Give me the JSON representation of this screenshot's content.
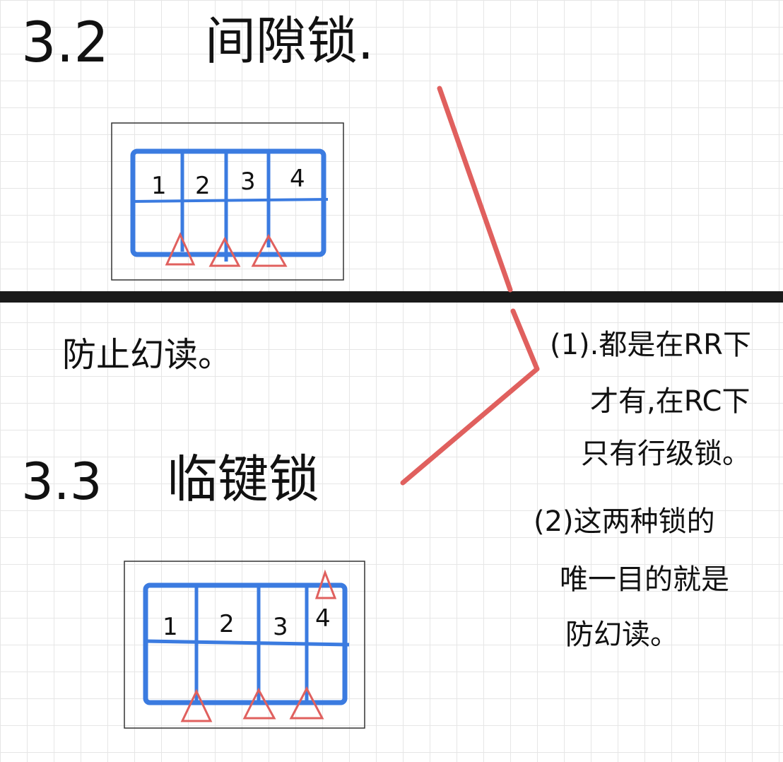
{
  "section_gap": {
    "number": "3.2",
    "title": "间隙锁."
  },
  "section_nextkey": {
    "number": "3.3",
    "title": "临键锁"
  },
  "purpose_note": "防止幻读。",
  "notes": [
    "(1).都是在RR下",
    "才有,在RC下",
    "只有行级锁。",
    "(2)这两种锁的",
    "唯一目的就是",
    "防幻读。"
  ],
  "gap_table": {
    "cells": [
      "1",
      "2",
      "3",
      "4"
    ]
  },
  "nextkey_table": {
    "cells": [
      "1",
      "2",
      "3",
      "4"
    ]
  },
  "colors": {
    "ink": "#111111",
    "table": "#3b7be0",
    "marker": "#e0605e",
    "divider": "#1a1a1a"
  }
}
